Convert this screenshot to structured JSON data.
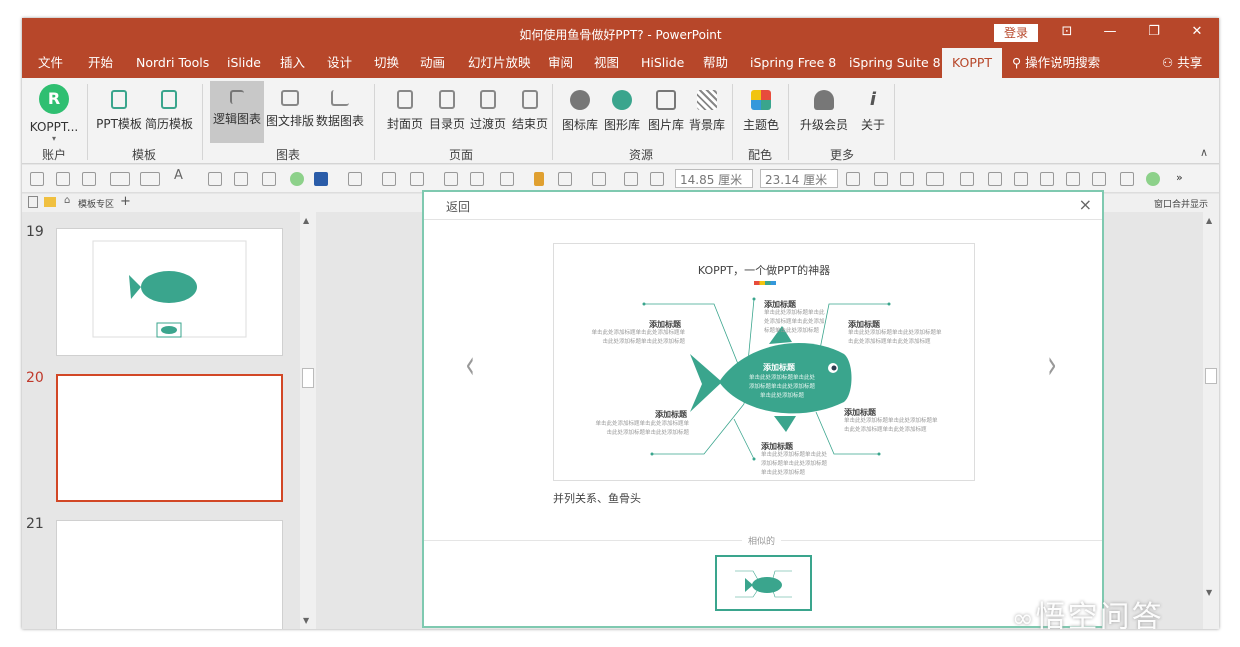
{
  "window": {
    "title": "如何使用鱼骨做好PPT? - PowerPoint",
    "login": "登录"
  },
  "menu": [
    "文件",
    "开始",
    "Nordri Tools",
    "iSlide",
    "插入",
    "设计",
    "切换",
    "动画",
    "幻灯片放映",
    "审阅",
    "视图",
    "HiSlide",
    "帮助",
    "iSpring Free 8",
    "iSpring Suite 8",
    "KOPPT"
  ],
  "tell_me": "操作说明搜索",
  "share": "共享",
  "ribbon": {
    "buttons": [
      "KOPPT...",
      "PPT模板",
      "简历模板",
      "逻辑图表",
      "图文排版",
      "数据图表",
      "封面页",
      "目录页",
      "过渡页",
      "结束页",
      "图标库",
      "图形库",
      "图片库",
      "背景库",
      "主题色",
      "升级会员",
      "关于"
    ],
    "groups": [
      "账户",
      "模板",
      "图表",
      "页面",
      "资源",
      "配色",
      "更多"
    ]
  },
  "format": {
    "width": "14.85 厘米",
    "height": "23.14 厘米"
  },
  "subbar": {
    "tab": "模板专区",
    "right": "窗口合并显示"
  },
  "slides": [
    "19",
    "20",
    "21"
  ],
  "dialog": {
    "back": "返回",
    "close": "×",
    "preview_title": "KOPPT，一个做PPT的神器",
    "add_title": "添加标题",
    "add_text": "单击此处添加标题单击此处添加标题单击此处添加标题单击此处添加标题",
    "caption": "并列关系、鱼骨头",
    "similar": "相似的"
  },
  "watermark": "悟空问答",
  "colors": {
    "brand": "#b7472a",
    "teal": "#3aa58d"
  }
}
